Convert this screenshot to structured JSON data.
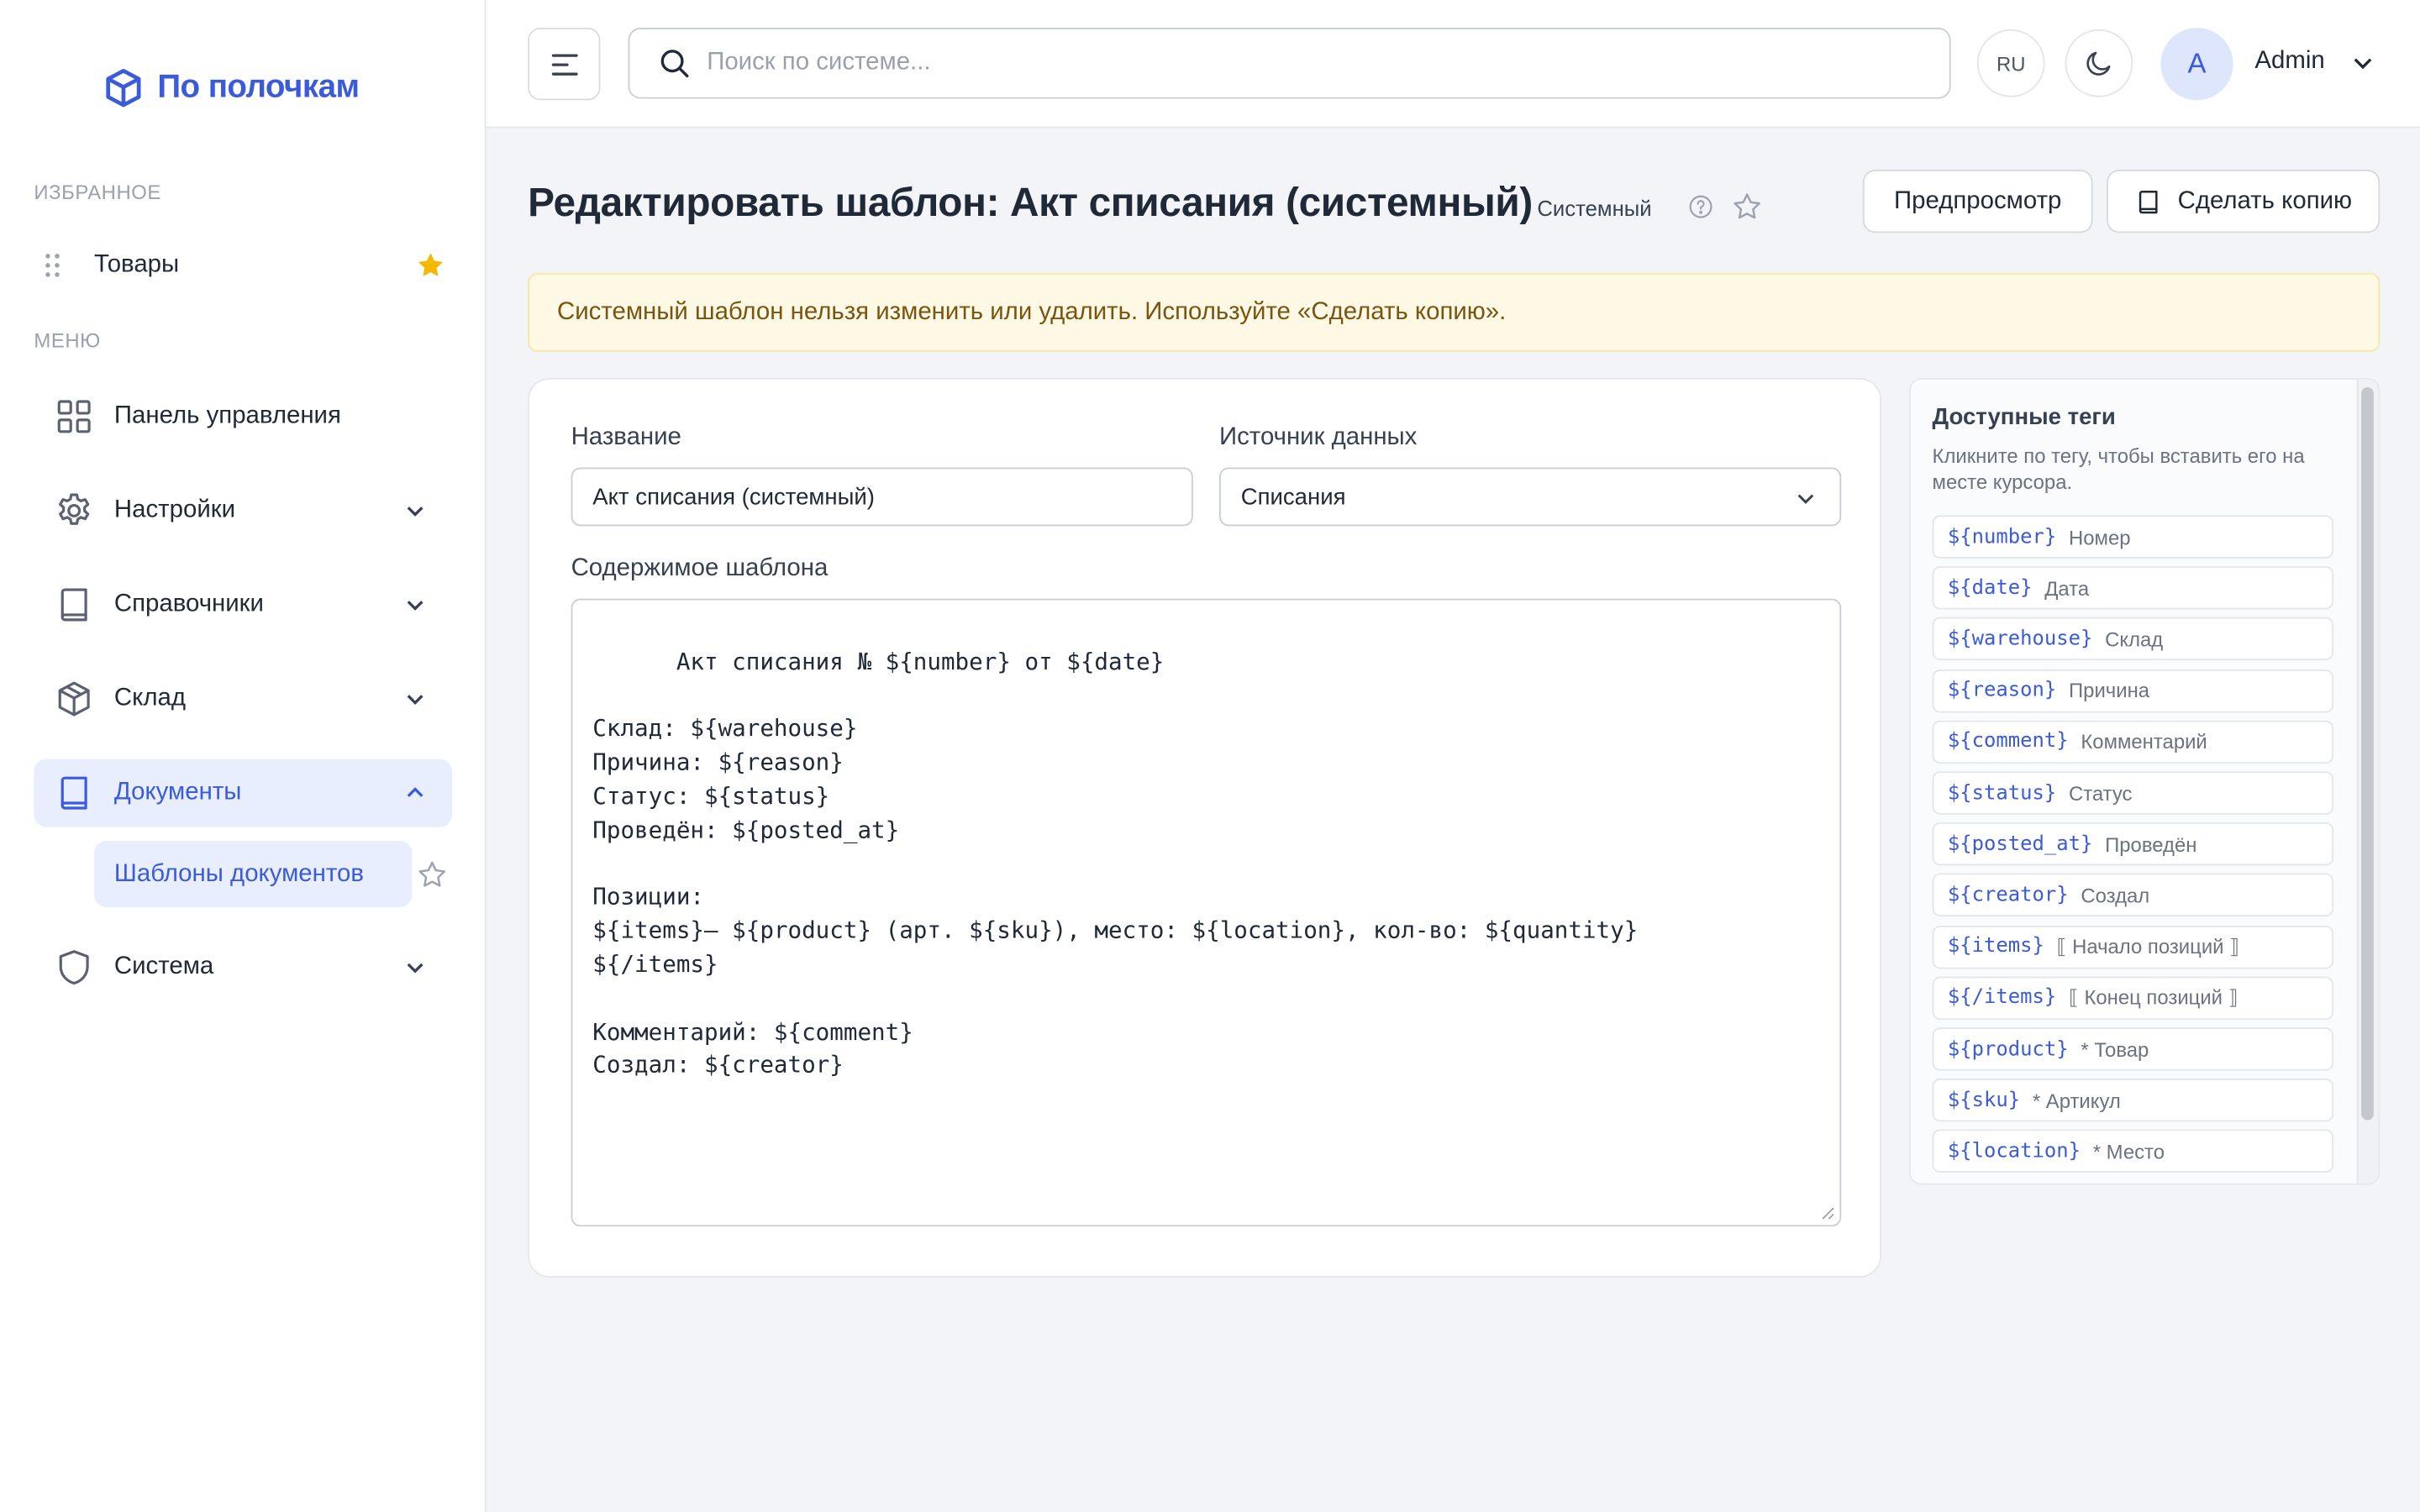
{
  "app": {
    "logo_text": "По полочкам",
    "brand_color": "#3b5bdb"
  },
  "sidebar": {
    "favorites_label": "ИЗБРАННОЕ",
    "favorites": [
      {
        "label": "Товары"
      }
    ],
    "menu_label": "МЕНЮ",
    "items": [
      {
        "label": "Панель управления",
        "icon": "grid-icon"
      },
      {
        "label": "Настройки",
        "icon": "gear-icon"
      },
      {
        "label": "Справочники",
        "icon": "book-icon"
      },
      {
        "label": "Склад",
        "icon": "box-icon"
      },
      {
        "label": "Документы",
        "icon": "book-icon",
        "active": true
      },
      {
        "label": "Система",
        "icon": "shield-icon"
      }
    ],
    "subitem_label": "Шаблоны документов"
  },
  "topbar": {
    "search_placeholder": "Поиск по системе...",
    "language": "RU",
    "user_initial": "A",
    "user_name": "Admin"
  },
  "header": {
    "title": "Редактировать шаблон: Акт списания (системный)",
    "badge": "Системный",
    "preview_button": "Предпросмотр",
    "copy_button": "Сделать копию"
  },
  "alert": {
    "text": "Системный шаблон нельзя изменить или удалить. Используйте «Сделать копию»."
  },
  "form": {
    "name_label": "Название",
    "name_value": "Акт списания (системный)",
    "source_label": "Источник данных",
    "source_value": "Списания",
    "content_label": "Содержимое шаблона",
    "content_value": "Акт списания № ${number} от ${date}\n\nСклад: ${warehouse}\nПричина: ${reason}\nСтатус: ${status}\nПроведён: ${posted_at}\n\nПозиции:\n${items}— ${product} (арт. ${sku}), место: ${location}, кол-во: ${quantity}\n${/items}\n\nКомментарий: ${comment}\nСоздал: ${creator}"
  },
  "tags_panel": {
    "title": "Доступные теги",
    "hint": "Кликните по тегу, чтобы вставить его на месте курсора.",
    "tags": [
      {
        "code": "${number}",
        "desc": "Номер"
      },
      {
        "code": "${date}",
        "desc": "Дата"
      },
      {
        "code": "${warehouse}",
        "desc": "Склад"
      },
      {
        "code": "${reason}",
        "desc": "Причина"
      },
      {
        "code": "${comment}",
        "desc": "Комментарий"
      },
      {
        "code": "${status}",
        "desc": "Статус"
      },
      {
        "code": "${posted_at}",
        "desc": "Проведён"
      },
      {
        "code": "${creator}",
        "desc": "Создал"
      },
      {
        "code": "${items}",
        "desc": "⟦ Начало позиций ⟧"
      },
      {
        "code": "${/items}",
        "desc": "⟦ Конец позиций ⟧"
      },
      {
        "code": "${product}",
        "desc": "* Товар"
      },
      {
        "code": "${sku}",
        "desc": "* Артикул"
      },
      {
        "code": "${location}",
        "desc": "* Место"
      }
    ]
  }
}
